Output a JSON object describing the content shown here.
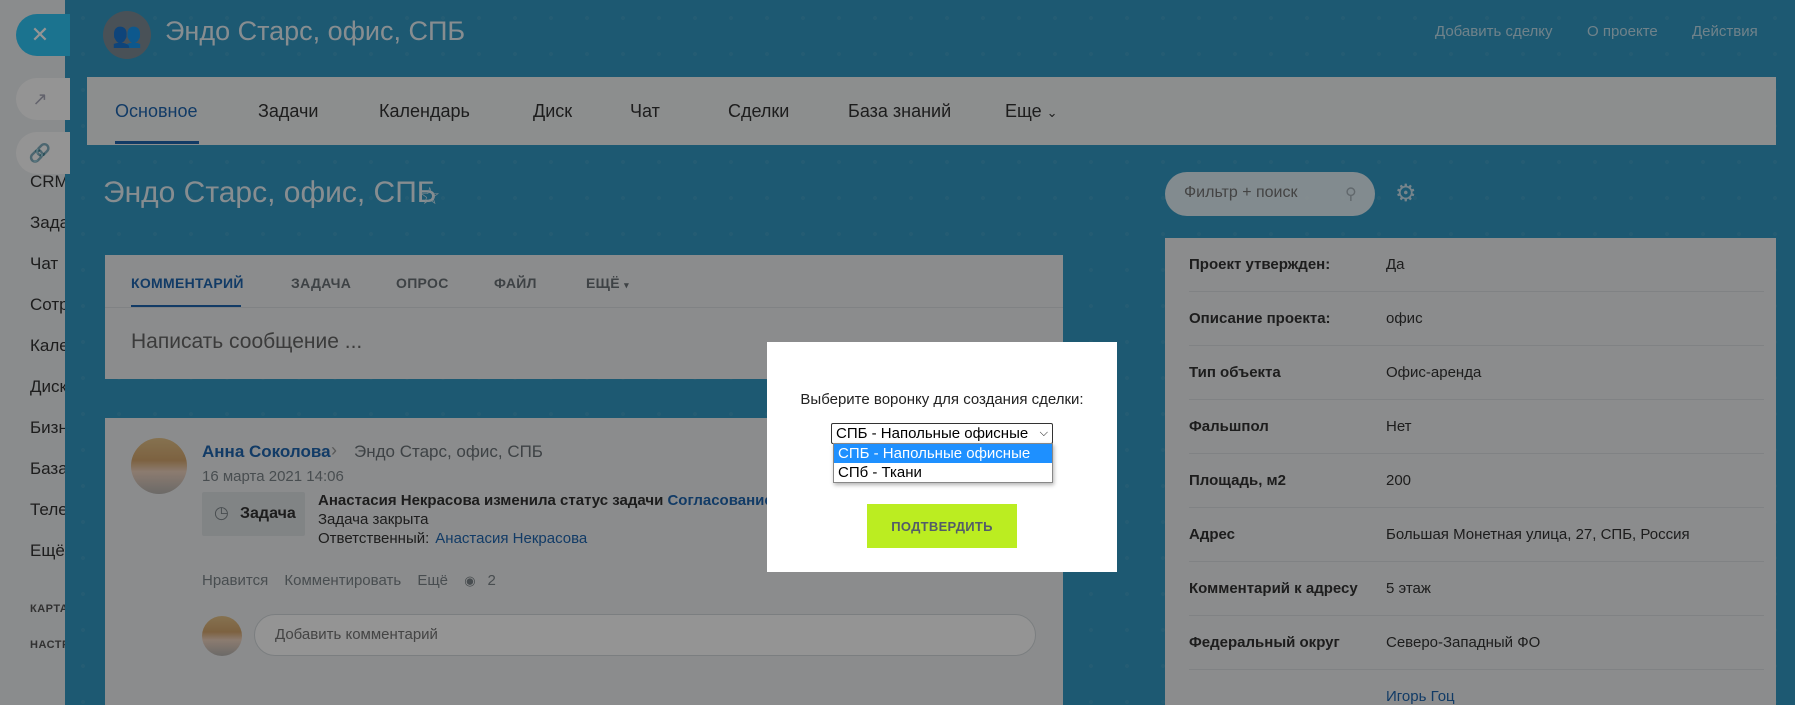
{
  "sidebar": {
    "items": [
      "CRM",
      "Задачи",
      "Чат",
      "Сотрудники",
      "Календарь",
      "Диск",
      "Бизнес",
      "База знаний",
      "Телефония",
      "Ещё"
    ],
    "sections": [
      "КАРТА",
      "НАСТРОЙКИ"
    ]
  },
  "header": {
    "group_title": "Эндо Старс, офис, СПБ",
    "links": [
      "Добавить сделку",
      "О проекте",
      "Действия"
    ]
  },
  "tabs": [
    "Основное",
    "Задачи",
    "Календарь",
    "Диск",
    "Чат",
    "Сделки",
    "База знаний",
    "Еще"
  ],
  "page_title": "Эндо Старс, офис, СПБ",
  "search": {
    "placeholder": "Фильтр + поиск"
  },
  "post_form": {
    "tabs": [
      "КОММЕНТАРИЙ",
      "ЗАДАЧА",
      "ОПРОС",
      "ФАЙЛ",
      "ЕЩЁ"
    ],
    "placeholder": "Написать сообщение ..."
  },
  "feed_post": {
    "author": "Анна Соколова",
    "destination": "Эндо Старс, офис, СПБ",
    "date": "16 марта 2021 14:06",
    "task_label": "Задача",
    "task_text": "Анастасия Некрасова изменила статус задачи",
    "task_status": "Согласование",
    "task_closed": "Задача закрыта",
    "responsible_label": "Ответственный:",
    "responsible_name": "Анастасия Некрасова",
    "actions": [
      "Нравится",
      "Комментировать",
      "Ещё"
    ],
    "views": "2",
    "comment_placeholder": "Добавить комментарий"
  },
  "info": [
    {
      "key": "Проект утвержден:",
      "value": "Да"
    },
    {
      "key": "Описание проекта:",
      "value": "офис"
    },
    {
      "key": "Тип объекта",
      "value": "Офис-аренда"
    },
    {
      "key": "Фальшпол",
      "value": "Нет"
    },
    {
      "key": "Площадь, м2",
      "value": "200"
    },
    {
      "key": "Адрес",
      "value": "Большая Монетная улица, 27, СПБ, Россия"
    },
    {
      "key": "Комментарий к адресу",
      "value": "5 этаж"
    },
    {
      "key": "Федеральный округ",
      "value": "Северо-Западный ФО"
    },
    {
      "key": "",
      "value": "Игорь Гоц"
    }
  ],
  "dialog": {
    "label": "Выберите воронку для создания сделки:",
    "selected": "СПБ - Напольные офисные",
    "options": [
      "СПБ - Напольные офисные",
      "СПб - Ткани"
    ],
    "confirm": "ПОДТВЕРДИТЬ"
  }
}
